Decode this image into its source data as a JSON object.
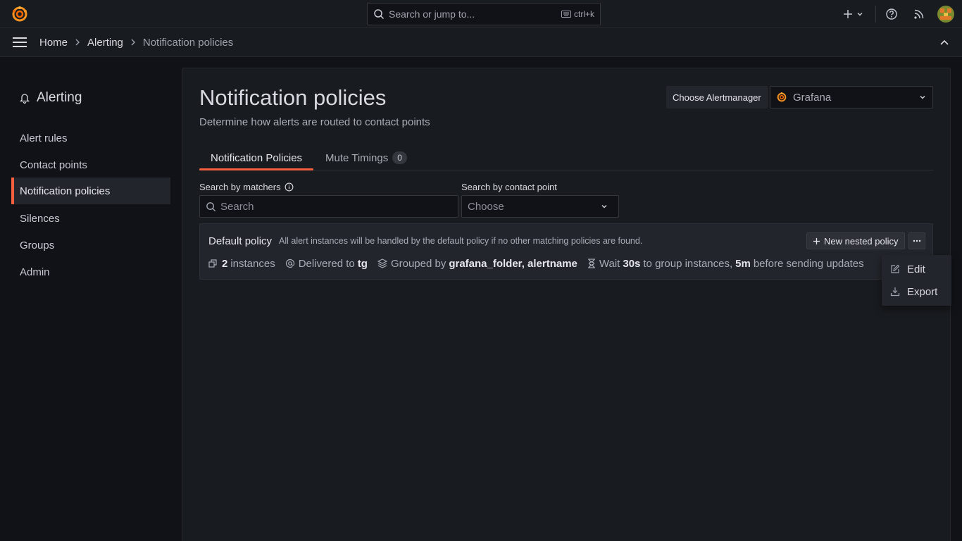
{
  "topbar": {
    "search_placeholder": "Search or jump to...",
    "shortcut": "ctrl+k"
  },
  "breadcrumb": {
    "items": [
      "Home",
      "Alerting",
      "Notification policies"
    ]
  },
  "sidebar": {
    "title": "Alerting",
    "items": [
      {
        "label": "Alert rules"
      },
      {
        "label": "Contact points"
      },
      {
        "label": "Notification policies"
      },
      {
        "label": "Silences"
      },
      {
        "label": "Groups"
      },
      {
        "label": "Admin"
      }
    ]
  },
  "main": {
    "title": "Notification policies",
    "subtitle": "Determine how alerts are routed to contact points",
    "alertmanager_label": "Choose Alertmanager",
    "alertmanager_value": "Grafana",
    "tabs": [
      {
        "label": "Notification Policies"
      },
      {
        "label": "Mute Timings",
        "count": "0"
      }
    ],
    "filters": {
      "matchers_label": "Search by matchers",
      "matchers_placeholder": "Search",
      "contact_label": "Search by contact point",
      "contact_placeholder": "Choose"
    },
    "policy": {
      "title": "Default policy",
      "description": "All alert instances will be handled by the default policy if no other matching policies are found.",
      "new_nested_label": "New nested policy",
      "instances_count": "2",
      "instances_text": "instances",
      "delivered_text": "Delivered to",
      "contact_point": "tg",
      "grouped_text": "Grouped by",
      "group_labels": "grafana_folder, alertname",
      "wait_text": "Wait",
      "group_wait": "30s",
      "group_wait_text": "to group instances,",
      "group_interval": "5m",
      "before_text": "before sending updates"
    },
    "menu": {
      "items": [
        {
          "label": "Edit",
          "icon": "edit-icon"
        },
        {
          "label": "Export",
          "icon": "download-icon"
        }
      ]
    }
  },
  "colors": {
    "accent": "#f55f3e",
    "background": "#111217",
    "panel": "#181b1f"
  }
}
